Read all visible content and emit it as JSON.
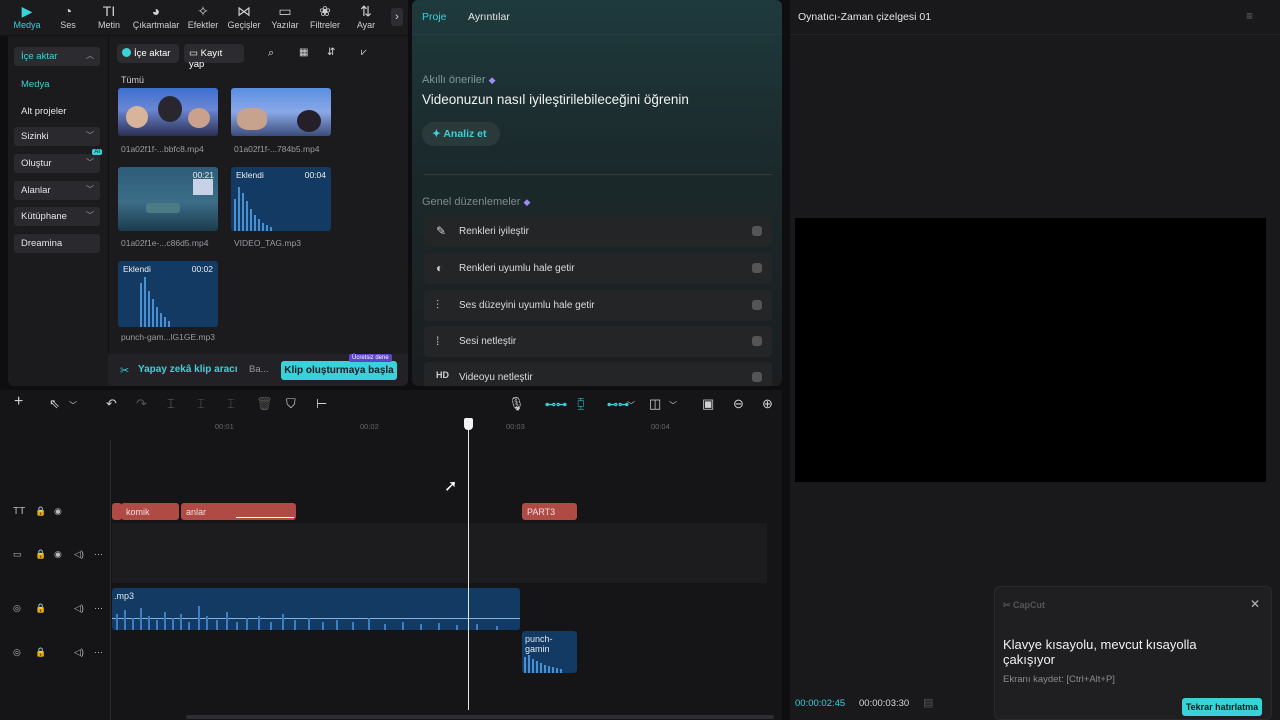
{
  "toolbar": {
    "tools": [
      {
        "label": "Medya",
        "icon": "media-icon",
        "glyph": "▶"
      },
      {
        "label": "Ses",
        "icon": "audio-icon",
        "glyph": "◔"
      },
      {
        "label": "Metin",
        "icon": "text-icon",
        "glyph": "TI"
      },
      {
        "label": "Çıkartmalar",
        "icon": "sticker-icon",
        "glyph": "◕"
      },
      {
        "label": "Efektler",
        "icon": "effects-icon",
        "glyph": "✧"
      },
      {
        "label": "Geçişler",
        "icon": "transitions-icon",
        "glyph": "⋈"
      },
      {
        "label": "Yazılar",
        "icon": "captions-icon",
        "glyph": "▭"
      },
      {
        "label": "Filtreler",
        "icon": "filters-icon",
        "glyph": "❀"
      },
      {
        "label": "Ayar",
        "icon": "adjust-icon",
        "glyph": "⇅"
      }
    ],
    "more": "›"
  },
  "sidebar": {
    "import": "İçe aktar",
    "media": "Medya",
    "subprojects": "Alt projeler",
    "yours": "Sizinki",
    "create": "Oluştur",
    "ai_badge": "AI",
    "spaces": "Alanlar",
    "library": "Kütüphane",
    "dreamina": "Dreamina"
  },
  "media": {
    "import_btn": "İçe aktar",
    "record_btn": "Kayıt yap",
    "all_label": "Tümü",
    "items": [
      {
        "name": "01a02f1f-...bbfc8.mp4"
      },
      {
        "name": "01a02f1f-...784b5.mp4"
      },
      {
        "name": "01a02f1e-...c86d5.mp4",
        "duration": "00:21"
      },
      {
        "name": "VIDEO_TAG.mp3",
        "duration": "00:04",
        "tag": "Eklendi"
      },
      {
        "name": "punch-gam...lG1GE.mp3",
        "duration": "00:02",
        "tag": "Eklendi"
      }
    ],
    "ai_clip_tool": "Yapay zekâ klip aracı",
    "truncated": "Ba...",
    "start_clip_btn": "Klip oluşturmaya başla",
    "free_trial": "Ücretsiz dene"
  },
  "details": {
    "tabs": [
      "Proje",
      "Ayrıntılar"
    ],
    "smart_title": "Akıllı öneriler",
    "smart_heading": "Videonuzun nasıl iyileştirilebileceğini öğrenin",
    "analyze_btn": "Analiz et",
    "general_title": "Genel düzenlemeler",
    "options": [
      {
        "label": "Renkleri iyileştir",
        "icon": "magic-wand-icon",
        "glyph": "✎"
      },
      {
        "label": "Renkleri uyumlu hale getir",
        "icon": "color-match-icon",
        "glyph": "◐"
      },
      {
        "label": "Ses düzeyini uyumlu hale getir",
        "icon": "volume-level-icon",
        "glyph": "⫶"
      },
      {
        "label": "Sesi netleştir",
        "icon": "audio-enhance-icon",
        "glyph": "⁞"
      },
      {
        "label": "Videoyu netleştir",
        "icon": "hd-icon",
        "glyph": "HD"
      }
    ]
  },
  "player": {
    "title": "Oynatıcı-Zaman çizelgesi 01",
    "current_time": "00:00:02:45",
    "total_time": "00:00:03:30"
  },
  "toast": {
    "brand": "CapCut",
    "title": "Klavye kısayolu, mevcut kısayolla çakışıyor",
    "subtitle": "Ekranı kaydet: [Ctrl+Alt+P]",
    "remind_btn": "Tekrar hatırlatma"
  },
  "timeline": {
    "ticks": [
      "00:01",
      "00:02",
      "00:03",
      "00:04"
    ],
    "clips": {
      "text1": "komik",
      "text2": "anlar",
      "text3": "PART3",
      "audio1": ".mp3",
      "audio2": "punch-gamin"
    }
  },
  "colors": {
    "accent": "#3ad1d9",
    "text_clip": "#b04a44",
    "audio_clip": "#123a63"
  }
}
